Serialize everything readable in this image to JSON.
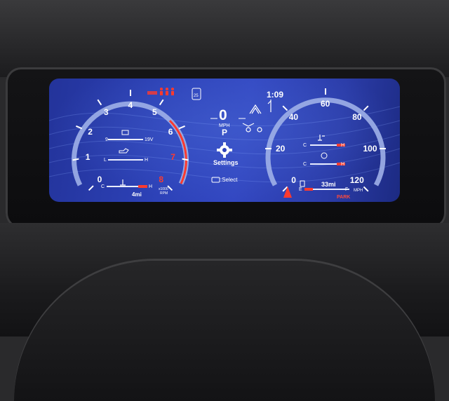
{
  "clock": "1:09",
  "tachometer": {
    "scale_labels": [
      "0",
      "1",
      "2",
      "3",
      "4",
      "5",
      "6",
      "7",
      "8"
    ],
    "unit_top": "x1000",
    "unit_bottom": "RPM",
    "trip": "4mi",
    "battery": {
      "low": "9",
      "high": "19V"
    },
    "oil_pressure": {
      "low": "L",
      "high": "H"
    },
    "coolant": {
      "low": "C",
      "high": "H"
    }
  },
  "speed": {
    "value": "0",
    "unit": "MPH",
    "gear": "P"
  },
  "settings_label": "Settings",
  "select_hint": ":Select",
  "speedometer": {
    "scale_labels": [
      "0",
      "20",
      "40",
      "60",
      "80",
      "100",
      "120"
    ],
    "unit": "MPH",
    "range": "33mi",
    "fuel": {
      "low": "E",
      "high": "F"
    },
    "oil_temp": {
      "low": "C",
      "high": "H"
    },
    "trans_temp": {
      "low": "C",
      "high": "H"
    },
    "park_label": "PARK"
  },
  "badge_date": "25",
  "colors": {
    "gauge_ring": "#9fb0e8",
    "redline": "#ff3a2e",
    "screen": "#2d42b8"
  }
}
